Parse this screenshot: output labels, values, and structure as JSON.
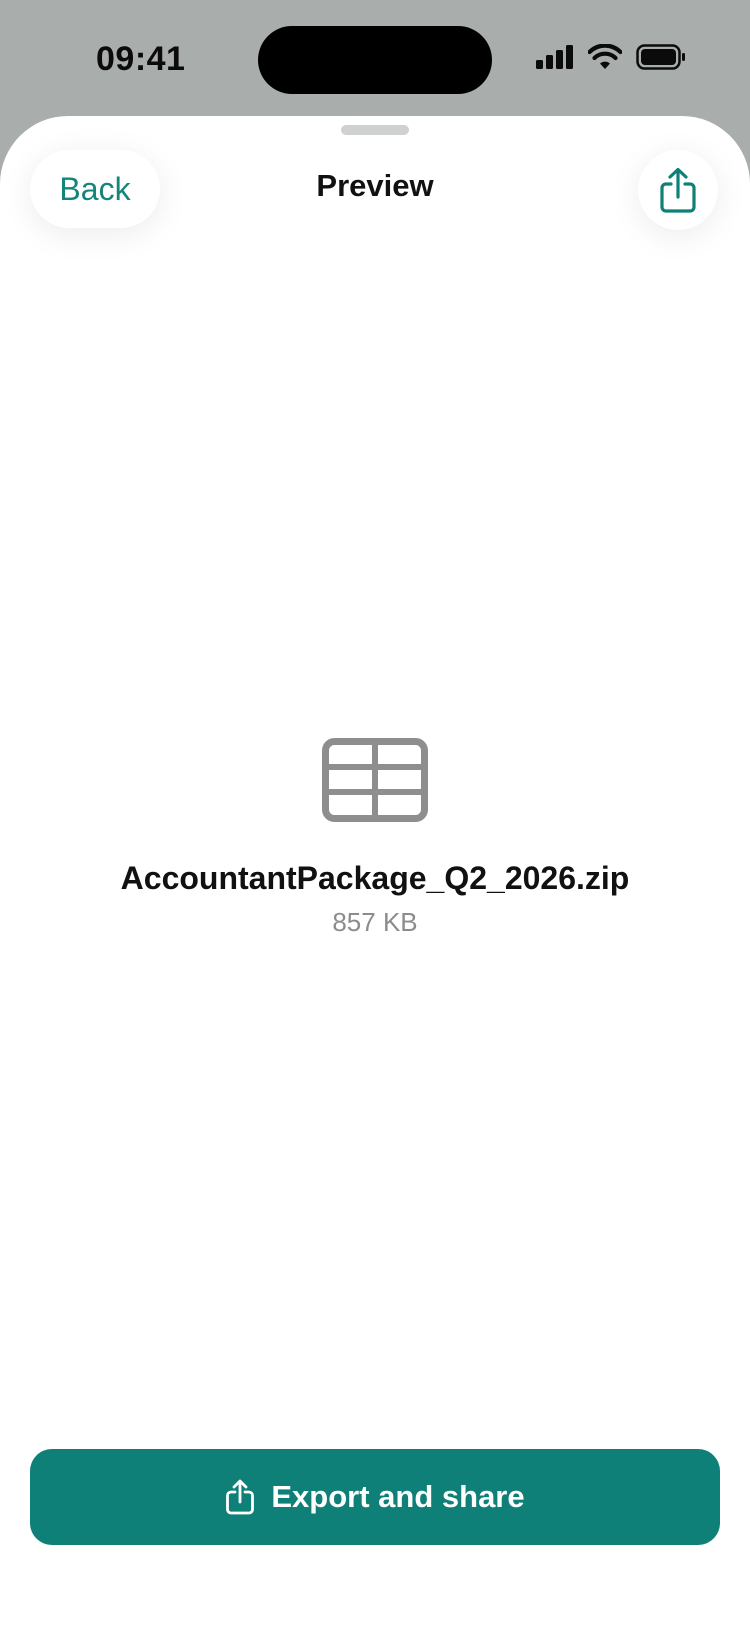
{
  "status_bar": {
    "time": "09:41",
    "icons": [
      "cellular-signal-icon",
      "wifi-icon",
      "battery-icon"
    ]
  },
  "nav": {
    "back_label": "Back",
    "title": "Preview",
    "share_icon": "share-icon"
  },
  "file": {
    "icon": "spreadsheet-table-icon",
    "name": "AccountantPackage_Q2_2026.zip",
    "size": "857 KB"
  },
  "actions": {
    "export_label": "Export and share",
    "export_icon": "share-icon"
  },
  "colors": {
    "accent": "#0f8077",
    "background_dim": "#a9adab",
    "sheet": "#ffffff",
    "secondary_text": "#8c8c8c",
    "icon_gray": "#8e8e8e"
  }
}
